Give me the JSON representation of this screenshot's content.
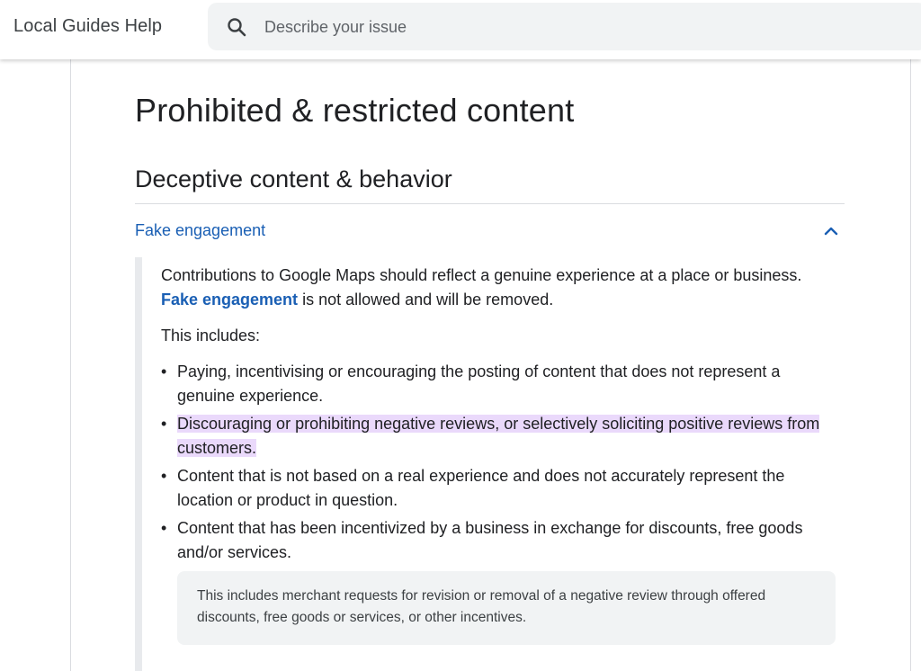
{
  "header": {
    "app_title": "Local Guides Help",
    "search": {
      "placeholder": "Describe your issue",
      "value": ""
    }
  },
  "page": {
    "title": "Prohibited & restricted content",
    "section_title": "Deceptive content & behavior"
  },
  "accordion": {
    "label": "Fake engagement",
    "expanded": true,
    "intro_text": "Contributions to Google Maps should reflect a genuine experience at a place or business.",
    "intro_link": "Fake engagement",
    "intro_tail": " is not allowed and will be removed.",
    "includes_label": "This includes:",
    "bullets": [
      "Paying, incentivising or encouraging the posting of content that does not represent a genuine experience.",
      "Discouraging or prohibiting negative reviews, or selectively soliciting positive reviews from customers.",
      "Content that is not based on a real experience and does not accurately represent the location or product in question.",
      "Content that has been incentivized by a business in exchange for discounts, free goods and/or services."
    ],
    "highlighted_bullet_index": 1,
    "note": "This includes merchant requests for revision or removal of a negative review through offered discounts, free goods or services, or other incentives."
  },
  "icons": {
    "search": "search-icon",
    "chevron": "chevron-up-icon"
  },
  "colors": {
    "link": "#1a5fb4",
    "highlight": "#ead9fb",
    "search_bg": "#f1f3f4",
    "note_bg": "#f1f3f4"
  }
}
